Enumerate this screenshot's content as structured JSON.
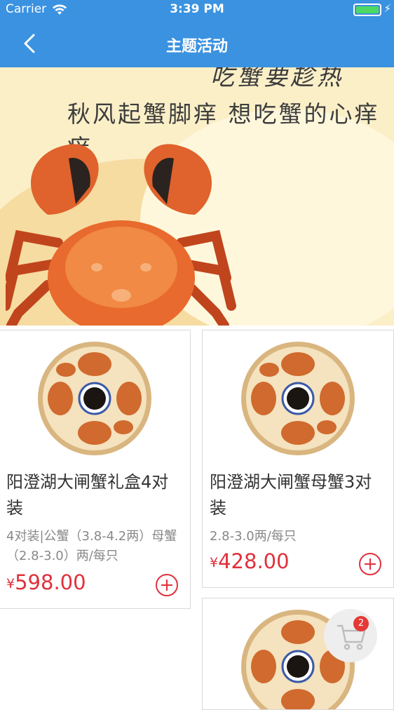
{
  "status_bar": {
    "carrier": "Carrier",
    "time": "3:39 PM"
  },
  "nav": {
    "title": "主题活动"
  },
  "banner": {
    "top_text": "吃蟹要趁热",
    "slogan": "秋风起蟹脚痒 想吃蟹的心痒痒"
  },
  "products": [
    {
      "name": "阳澄湖大闸蟹礼盒4对装",
      "spec": "4对装|公蟹（3.8-4.2两）母蟹（2.8-3.0）两/每只",
      "currency": "¥",
      "price": "598.00"
    },
    {
      "name": "阳澄湖大闸蟹母蟹3对装",
      "spec": "2.8-3.0两/每只",
      "currency": "¥",
      "price": "428.00"
    }
  ],
  "cart": {
    "count": "2"
  },
  "colors": {
    "nav": "#3b92e0",
    "price": "#e0303b",
    "badge": "#e53935"
  },
  "icons": [
    "wifi-icon",
    "battery-icon",
    "back-chevron-icon",
    "add-circle-icon",
    "cart-icon"
  ]
}
